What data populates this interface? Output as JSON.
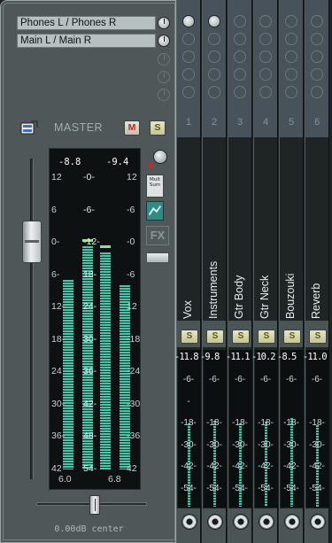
{
  "master": {
    "hw_outputs": [
      "Phones L / Phones R",
      "Main L / Main R"
    ],
    "label": "MASTER",
    "mute_label": "M",
    "solo_label": "S",
    "peak_left": "-8.8",
    "peak_right": "-9.4",
    "fx_label": "FX",
    "mono_label": "Mult Sum",
    "pan_label": "0.00dB  center",
    "scale_center": [
      "-0-",
      "-6-",
      "-12-",
      "18-",
      "24-",
      "30-",
      "36-",
      "42-",
      "48-",
      "54-"
    ],
    "scale_left": [
      "12",
      "6",
      "0-",
      "6-",
      "12-",
      "18-",
      "24",
      "30-",
      "36-",
      "42"
    ],
    "scale_right": [
      "12",
      "-6",
      "-0",
      "-6",
      "12",
      "-18",
      "-24",
      "-30",
      "-36",
      "42"
    ],
    "bottom_left": "6.0",
    "bottom_right": "6.8"
  },
  "tracks": [
    {
      "num": "1",
      "name": "Vox",
      "peak": "-11.8",
      "ticks": [
        "-6-",
        "-",
        "-18-",
        "-30-",
        "-42-",
        "-54-"
      ]
    },
    {
      "num": "2",
      "name": "Instruments",
      "peak": "-9.8",
      "ticks": [
        "-6-",
        "",
        "-18-",
        "-30-",
        "-42-",
        "-54-"
      ]
    },
    {
      "num": "3",
      "name": "Gtr Body",
      "peak": "-11.1",
      "ticks": [
        "-6-",
        "",
        "-18-",
        "-30-",
        "-42-",
        "-54-"
      ]
    },
    {
      "num": "4",
      "name": "Gtr Neck",
      "peak": "-10.2",
      "ticks": [
        "-6-",
        "",
        "-18-",
        "-30-",
        "-42-",
        "-54-"
      ]
    },
    {
      "num": "5",
      "name": "Bouzouki",
      "peak": "-8.5",
      "ticks": [
        "-6-",
        "",
        "-18-",
        "-30-",
        "-42-",
        "-54-"
      ]
    },
    {
      "num": "6",
      "name": "Reverb",
      "peak": "-11.0",
      "ticks": [
        "-6-",
        "",
        "-18-",
        "-30-",
        "-42-",
        "-54-"
      ]
    }
  ],
  "track_solo_label": "S",
  "meters": {
    "master_left_level": 0.74,
    "master_right_level": 0.72,
    "track_levels": [
      0.58,
      0.6,
      0.58,
      0.59,
      0.62,
      0.57
    ]
  },
  "colors": {
    "meter": "#43c7ad",
    "mute_text": "#c0281e",
    "track_header": "#48525a"
  }
}
